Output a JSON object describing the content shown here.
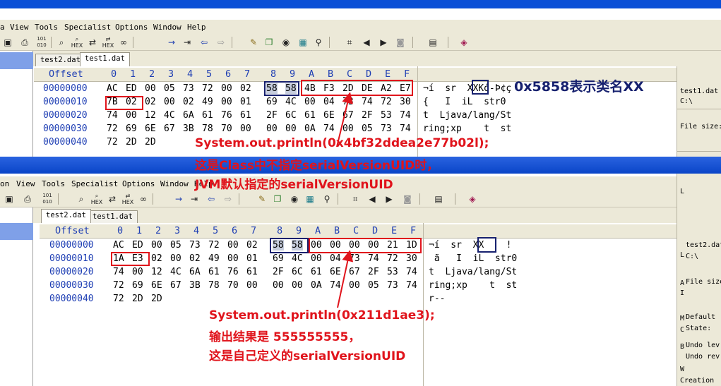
{
  "menus": [
    "a",
    "View",
    "Tools",
    "Specialist",
    "Options",
    "Window",
    "Help"
  ],
  "menus_b": [
    "on",
    "View",
    "Tools",
    "Specialist",
    "Options",
    "Window",
    "Help"
  ],
  "toolbar_icons": [
    "save-icon",
    "print-icon",
    "binary-icon",
    "find-icon",
    "find-hex-icon",
    "find-replace-icon",
    "find-replace-hex-icon",
    "find-binoculars-icon",
    "goto-arrow-icon",
    "goto-offset-icon",
    "back-arrow-icon",
    "forward-arrow-icon",
    "clipboard-icon",
    "windows-icon",
    "disk-icon",
    "calculator-icon",
    "magnify-icon",
    "block-icon",
    "prev-icon",
    "next-icon",
    "camera-icon",
    "table-icon",
    "book-icon"
  ],
  "window1": {
    "tabs": [
      "test2.dat",
      "test1.dat"
    ],
    "header": {
      "offset": "Offset",
      "columns": [
        "0",
        "1",
        "2",
        "3",
        "4",
        "5",
        "6",
        "7",
        "8",
        "9",
        "A",
        "B",
        "C",
        "D",
        "E",
        "F"
      ]
    },
    "rows": [
      {
        "offset": "00000000",
        "bytes": [
          "AC",
          "ED",
          "00",
          "05",
          "73",
          "72",
          "00",
          "02",
          "58",
          "58",
          "4B",
          "F3",
          "2D",
          "DE",
          "A2",
          "E7"
        ],
        "ascii": "¬í  sr  XXKó-Þ¢ç"
      },
      {
        "offset": "00000010",
        "bytes": [
          "7B",
          "02",
          "02",
          "00",
          "02",
          "49",
          "00",
          "01",
          "69",
          "4C",
          "00",
          "04",
          "73",
          "74",
          "72",
          "30"
        ],
        "ascii": "{   I  iL  str0"
      },
      {
        "offset": "00000020",
        "bytes": [
          "74",
          "00",
          "12",
          "4C",
          "6A",
          "61",
          "76",
          "61",
          "2F",
          "6C",
          "61",
          "6E",
          "67",
          "2F",
          "53",
          "74"
        ],
        "ascii": "t  Ljava/lang/St"
      },
      {
        "offset": "00000030",
        "bytes": [
          "72",
          "69",
          "6E",
          "67",
          "3B",
          "78",
          "70",
          "00",
          "00",
          "00",
          "0A",
          "74",
          "00",
          "05",
          "73",
          "74"
        ],
        "ascii": "ring;xp    t  st"
      },
      {
        "offset": "00000040",
        "bytes": [
          "72",
          "2D",
          "2D"
        ],
        "ascii": ""
      }
    ]
  },
  "window2": {
    "tabs": [
      "test2.dat",
      "test1.dat"
    ],
    "header": {
      "offset": "Offset",
      "columns": [
        "0",
        "1",
        "2",
        "3",
        "4",
        "5",
        "6",
        "7",
        "8",
        "9",
        "A",
        "B",
        "C",
        "D",
        "E",
        "F"
      ]
    },
    "rows": [
      {
        "offset": "00000000",
        "bytes": [
          "AC",
          "ED",
          "00",
          "05",
          "73",
          "72",
          "00",
          "02",
          "58",
          "58",
          "00",
          "00",
          "00",
          "00",
          "21",
          "1D"
        ],
        "ascii": "¬í  sr  XX    !"
      },
      {
        "offset": "00000010",
        "bytes": [
          "1A",
          "E3",
          "02",
          "00",
          "02",
          "49",
          "00",
          "01",
          "69",
          "4C",
          "00",
          "04",
          "73",
          "74",
          "72",
          "30"
        ],
        "ascii": " ã   I  iL  str0"
      },
      {
        "offset": "00000020",
        "bytes": [
          "74",
          "00",
          "12",
          "4C",
          "6A",
          "61",
          "76",
          "61",
          "2F",
          "6C",
          "61",
          "6E",
          "67",
          "2F",
          "53",
          "74"
        ],
        "ascii": "t  Ljava/lang/St"
      },
      {
        "offset": "00000030",
        "bytes": [
          "72",
          "69",
          "6E",
          "67",
          "3B",
          "78",
          "70",
          "00",
          "00",
          "00",
          "0A",
          "74",
          "00",
          "05",
          "73",
          "74"
        ],
        "ascii": "ring;xp    t  st"
      },
      {
        "offset": "00000040",
        "bytes": [
          "72",
          "2D",
          "2D"
        ],
        "ascii": "r--"
      }
    ]
  },
  "annotations": {
    "class_name_note": "0x5858表示类名XX",
    "top_line1": "System.out.println(0x4bf32ddea2e77b02l);",
    "top_line2": "这是Class中不指定serialVersionUID时，",
    "top_line3": "JVM默认指定的serialVersionUID",
    "bottom_line1": "System.out.println(0x211d1ae3);",
    "bottom_line2": "输出结果是 555555555，",
    "bottom_line3": "这是自己定义的serialVersionUID"
  },
  "right_panel_1": {
    "file_name": "test1.dat",
    "path": "C:\\",
    "file_size_label": "File size:"
  },
  "right_panel_2": {
    "file_name": "test2.dat",
    "path": "C:\\",
    "file_size_label": "File size",
    "default_label": "Default",
    "state_label": "State:",
    "undo_level_label": "Undo lev",
    "undo_reverse_label": "Undo rev",
    "creation_label": "Creation",
    "side_letters": [
      "L",
      "A",
      "I",
      "M",
      "C",
      "B",
      "W"
    ]
  },
  "colors": {
    "annotation_red": "#e0141c",
    "annotation_blue": "#16206e",
    "header_blue": "#1f3fb4",
    "selection": "#c6cddd"
  }
}
